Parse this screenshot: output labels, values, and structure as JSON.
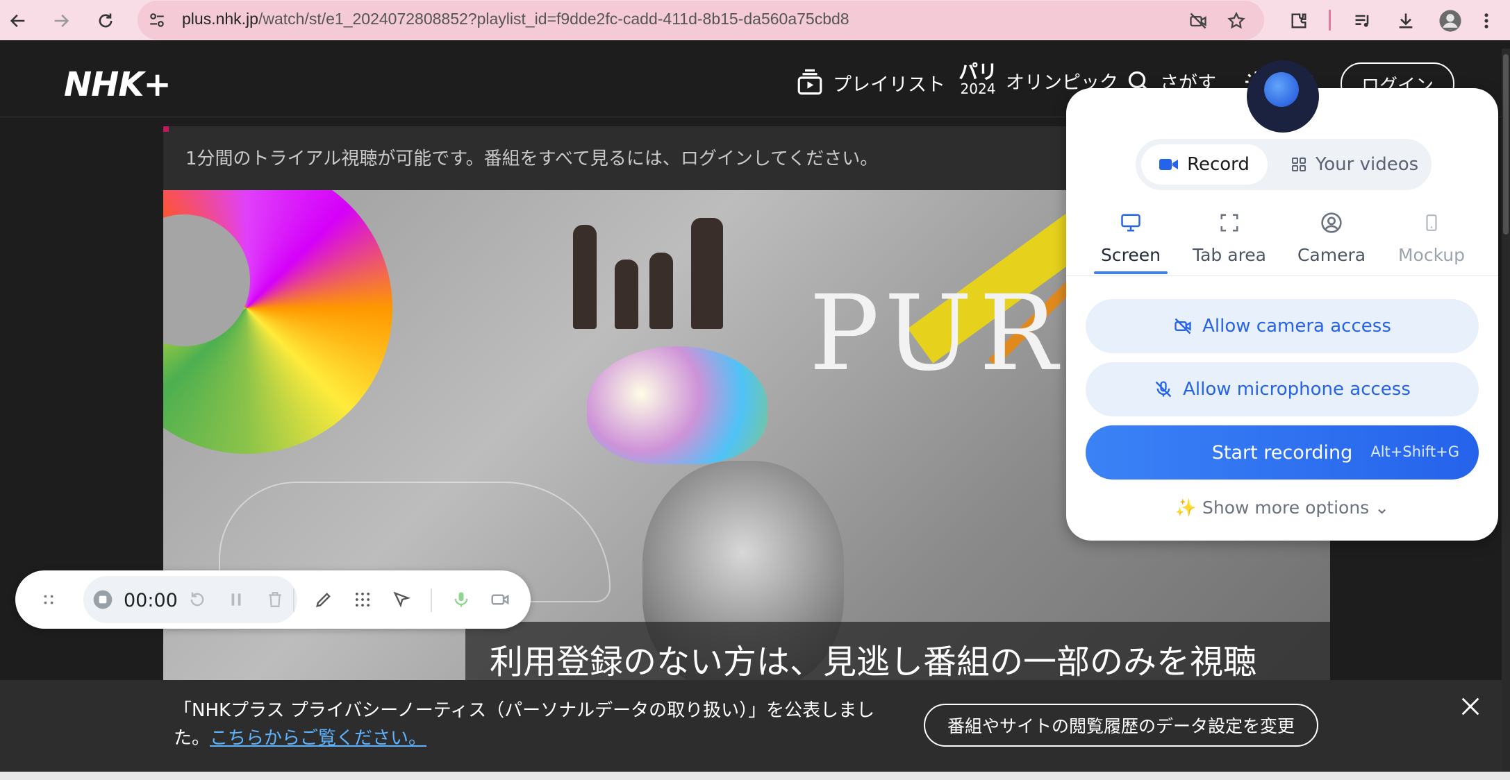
{
  "browser": {
    "url_host": "plus.nhk.jp",
    "url_path": "/watch/st/e1_2024072808852?playlist_id=f9dde2fc-cadd-411d-8b15-da560a75cbd8"
  },
  "nhk": {
    "logo": "NHK+",
    "nav": {
      "playlist": "プレイリスト",
      "olympic_top": "パリ",
      "olympic_year": "2024",
      "olympic": "オリンピック",
      "search": "さがす",
      "settings": "設定",
      "login": "ログイン"
    },
    "trial_notice": "1分間のトライアル視聴が可能です。番組をすべて見るには、ログインしてください。",
    "video": {
      "overlay_text": "PUR",
      "subtitle": "利用登録のない方は、見逃し番組の一部のみを視聴"
    },
    "privacy": {
      "text": "「NHKプラス プライバシーノーティス（パーソナルデータの取り扱い）」を公表しました。",
      "link": "こちらからご覧ください。",
      "button": "番組やサイトの閲覧履歴のデータ設定を変更"
    }
  },
  "recorder": {
    "toolbar": {
      "time": "00:00"
    },
    "popup": {
      "tab_record": "Record",
      "tab_videos": "Your videos",
      "modes": [
        "Screen",
        "Tab area",
        "Camera",
        "Mockup"
      ],
      "allow_camera": "Allow camera access",
      "allow_mic": "Allow microphone access",
      "start": "Start recording",
      "shortcut": "Alt+Shift+G",
      "more": "Show more options"
    },
    "accent": "#3b82f6"
  }
}
